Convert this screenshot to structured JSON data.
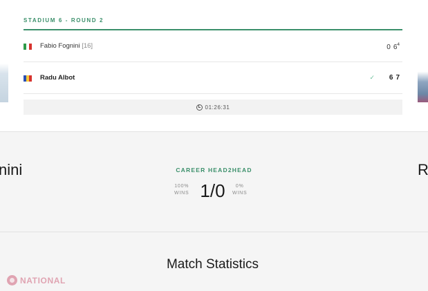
{
  "match": {
    "header": "STADIUM 6 - ROUND 2",
    "players": [
      {
        "name": "Fabio Fognini",
        "seed": "[16]",
        "flag_colors": [
          "#2e9a48",
          "#ffffff",
          "#d7332e"
        ],
        "sets": [
          {
            "score": "0",
            "tiebreak": ""
          },
          {
            "score": "6",
            "tiebreak": "4"
          }
        ],
        "winner": false
      },
      {
        "name": "Radu Albot",
        "seed": "",
        "flag_colors": [
          "#2a4fb3",
          "#f6c93b",
          "#d7332e"
        ],
        "sets": [
          {
            "score": "6",
            "tiebreak": ""
          },
          {
            "score": "7",
            "tiebreak": ""
          }
        ],
        "winner": true,
        "winner_mark": "✓"
      }
    ],
    "duration": "01:26:31"
  },
  "h2h": {
    "left_name": "nini",
    "right_name": "R",
    "title": "CAREER HEAD2HEAD",
    "score": "1/0",
    "left_pct": "100%",
    "left_label": "WINS",
    "right_pct": "0%",
    "right_label": "WINS"
  },
  "stats": {
    "title": "Match Statistics"
  },
  "watermark": {
    "text": "NATIONAL"
  },
  "colors": {
    "accent": "#3a8f6a",
    "winner_check": "#6dbf9a"
  }
}
